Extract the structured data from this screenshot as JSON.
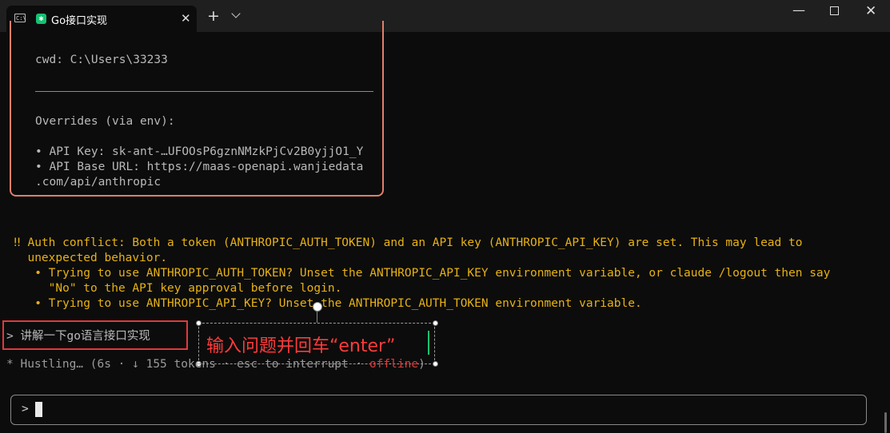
{
  "window": {
    "tab_title": "Go接口实现",
    "tab_close": "✕",
    "new_tab": "+",
    "cmd_icon_text": "C:\\",
    "minimize": "—",
    "close": "✕"
  },
  "panel": {
    "cwd": "cwd: C:\\Users\\33233",
    "overrides_heading": "Overrides (via env):",
    "api_key": "• API Key: sk-ant-…UFOOsP6gznNMzkPjCv2B0yjjO1_Y",
    "api_base_1": "• API Base URL: https://maas-openapi.wanjiedata",
    "api_base_2": ".com/api/anthropic"
  },
  "warning": {
    "line1": "‼ Auth conflict: Both a token (ANTHROPIC_AUTH_TOKEN) and an API key (ANTHROPIC_API_KEY) are set. This may lead to",
    "line2": "  unexpected behavior.",
    "line3": "   • Trying to use ANTHROPIC_AUTH_TOKEN? Unset the ANTHROPIC_API_KEY environment variable, or claude /logout then say",
    "line4": "     \"No\" to the API key approval before login.",
    "line5": "   • Trying to use ANTHROPIC_API_KEY? Unset the ANTHROPIC_AUTH_TOKEN environment variable."
  },
  "conversation": {
    "user_prompt": "> 讲解一下go语言接口实现",
    "annotation": "输入问题并回车“enter”",
    "status_prefix": "* Hustling… (6s · ↓ 155 tokens · esc to interrupt · ",
    "status_offline": "offline",
    "status_suffix": ")"
  },
  "input": {
    "prompt_symbol": ">"
  },
  "colors": {
    "panel_border": "#e0806a",
    "warning": "#e7b214",
    "highlight_box": "#e03a3a",
    "annotation_text": "#ff3b3b"
  }
}
